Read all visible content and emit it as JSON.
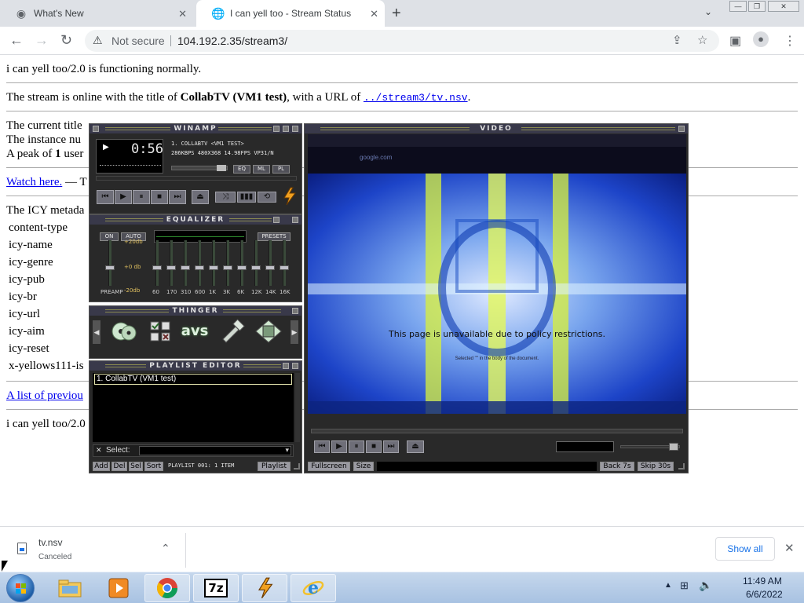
{
  "browser": {
    "tabs": [
      {
        "title": "What's New",
        "active": false
      },
      {
        "title": "I can yell too - Stream Status",
        "active": true
      }
    ],
    "address": {
      "security_label": "Not secure",
      "url": "104.192.2.35/stream3/"
    }
  },
  "page": {
    "status_line": "i can yell too/2.0 is functioning normally.",
    "stream_line": {
      "prefix": "The stream is online with the title of ",
      "title": "CollabTV (VM1 test)",
      "middle": ", with a URL of ",
      "url": "../stream3/tv.nsv",
      "suffix": "."
    },
    "current_title_line": "The current title",
    "instance_line": "The instance nu",
    "peak_line": {
      "prefix": "A peak of ",
      "count": "1",
      "suffix": " user"
    },
    "watch_link": "Watch here.",
    "watch_suffix": " — T",
    "icy_intro": "The ICY metada",
    "icy_fields": [
      "content-type",
      "icy-name",
      "icy-genre",
      "icy-pub",
      "icy-br",
      "icy-url",
      "icy-aim",
      "icy-reset",
      "x-yellows111-is"
    ],
    "list_link": "A list of previou",
    "footer_line": "i can yell too/2.0"
  },
  "winamp": {
    "main": {
      "title": "WINAMP",
      "time": "0:56",
      "track_marquee": "1. COLLABTV <VM1 TEST>",
      "info": "286KBPS 480X368 14.98FPS VP31/N",
      "buttons": [
        "EQ",
        "ML",
        "PL"
      ]
    },
    "equalizer": {
      "title": "EQUALIZER",
      "on_label": "ON",
      "auto_label": "AUTO",
      "presets_label": "PRESETS",
      "db_top": "+20db",
      "db_mid": "+0 db",
      "db_bot": "-20db",
      "preamp_label": "PREAMP",
      "bands": [
        "60",
        "170",
        "310",
        "600",
        "1K",
        "3K",
        "6K",
        "12K",
        "14K",
        "16K"
      ]
    },
    "thinger": {
      "title": "THINGER",
      "items": [
        "cd-icon",
        "options-icon",
        "avs-icon",
        "tools-icon",
        "skin-icon"
      ],
      "avs_text": "avs"
    },
    "playlist": {
      "title": "PLAYLIST EDITOR",
      "items": [
        "1. CollabTV (VM1 test)"
      ],
      "select_label": "Select:",
      "status": "PLAYLIST 001: 1 ITEM",
      "buttons": [
        "Add",
        "Del",
        "Sel",
        "Sort"
      ],
      "playlist_button": "Playlist"
    },
    "video": {
      "title": "VIDEO",
      "overlay_text": "This page is unavailable due to policy restrictions.",
      "overlay_sub": "Selected \"\" in the body of the document.",
      "site_text": "google.com",
      "controls": {
        "fullscreen": "Fullscreen",
        "size": "Size",
        "back": "Back 7s",
        "skip": "Skip 30s"
      }
    }
  },
  "downloads": {
    "file_name": "tv.nsv",
    "file_status": "Canceled",
    "show_all": "Show all"
  },
  "taskbar": {
    "time": "11:49 AM",
    "date": "6/6/2022",
    "seven_zip": "7z"
  }
}
